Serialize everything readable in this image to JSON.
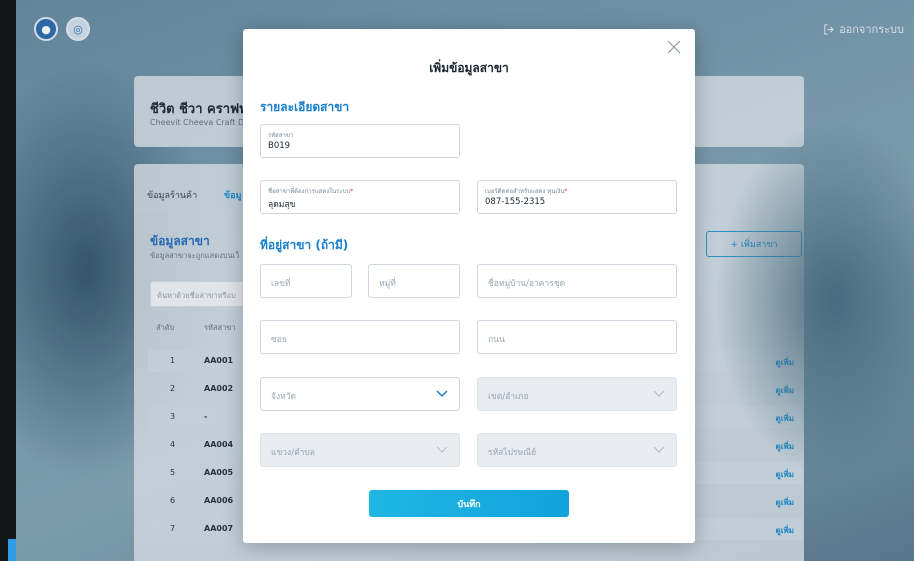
{
  "app": {
    "logout_label": "ออกจากระบบ"
  },
  "background": {
    "shop_name": "ชีวิต ชีวา คราฟท์",
    "shop_subtitle": "Cheevit Cheeva Craft D",
    "tabs": [
      "ข้อมูลร้านค้า",
      "ข้อมู"
    ],
    "section_title": "ข้อมูลสาขา",
    "section_subtitle": "ข้อมูลสาขาจะถูกแสดงบนเว็",
    "add_branch_label": "+ เพิ่มสาขา",
    "search_placeholder": "ค้นหาด้วยชื่อสาขาหรือบ",
    "table_headers": [
      "ลำดับ",
      "รหัสสาขา"
    ],
    "rows": [
      {
        "num": "1",
        "code": "AA001",
        "action": "ดูเพิ่ม"
      },
      {
        "num": "2",
        "code": "AA002",
        "action": "ดูเพิ่ม"
      },
      {
        "num": "3",
        "code": "-",
        "action": "ดูเพิ่ม"
      },
      {
        "num": "4",
        "code": "AA004",
        "action": "ดูเพิ่ม"
      },
      {
        "num": "5",
        "code": "AA005",
        "action": "ดูเพิ่ม"
      },
      {
        "num": "6",
        "code": "AA006",
        "action": "ดูเพิ่ม"
      },
      {
        "num": "7",
        "code": "AA007",
        "action": "ดูเพิ่ม"
      }
    ]
  },
  "modal": {
    "title": "เพิ่มข้อมูลสาขา",
    "details_heading": "รายละเอียดสาขา",
    "branch_code": {
      "label": "รหัสสาขา",
      "value": "B019"
    },
    "branch_display_name": {
      "label": "ชื่อสาขาที่ต้องการแสดงในระบบ",
      "required_mark": "*",
      "value": "ลุดมสุข"
    },
    "phone": {
      "label": "เบอร์ติดต่อสำหรับแสดง ทุนเงิน",
      "required_mark": "*",
      "value": "087-155-2315"
    },
    "address_heading": "ที่อยู่สาขา (ถ้ามี)",
    "house_no_placeholder": "เลขที่",
    "moo_placeholder": "หมู่ที่",
    "village_placeholder": "ชื่อหมู่บ้าน/อาคารชุด",
    "soi_placeholder": "ซอย",
    "road_placeholder": "ถนน",
    "province_placeholder": "จังหวัด",
    "district_placeholder": "เขต/อำเภอ",
    "subdistrict_placeholder": "แขวง/ตำบล",
    "postcode_placeholder": "รหัสไปรษณีย์",
    "save_label": "บันทึก"
  },
  "colors": {
    "accent": "#1a80cf",
    "button": "#15a8de",
    "required": "#e0393e",
    "disabled_field": "#e8ecf1"
  },
  "icons": [
    "close-icon",
    "chevron-down-icon",
    "logout-icon"
  ]
}
